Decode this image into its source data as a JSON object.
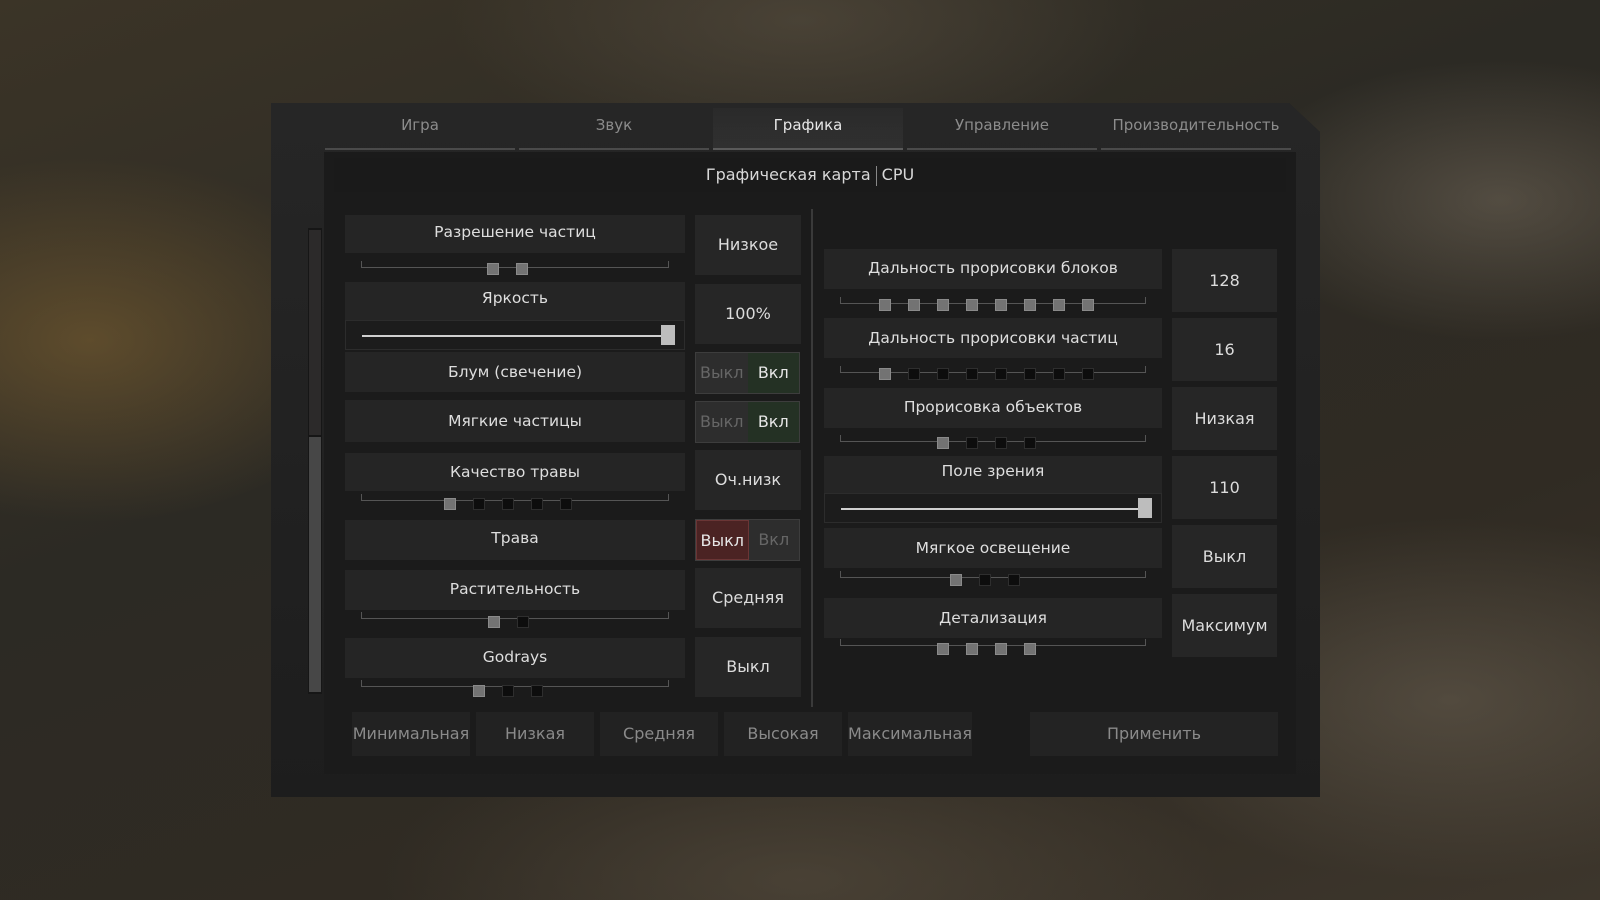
{
  "tabs": [
    "Игра",
    "Звук",
    "Графика",
    "Управление",
    "Производительность"
  ],
  "active_tab": "Графика",
  "subtabs": {
    "gpu": "Графическая карта",
    "cpu": "CPU"
  },
  "left": {
    "particle_res": {
      "label": "Разрешение частиц",
      "value": "Низкое",
      "levels": 2,
      "selected": 2
    },
    "brightness": {
      "label": "Яркость",
      "value": "100%",
      "level": 1.0
    },
    "bloom": {
      "label": "Блум (свечение)",
      "off": "Выкл",
      "on": "Вкл",
      "state": "on"
    },
    "soft_particles": {
      "label": "Мягкие частицы",
      "off": "Выкл",
      "on": "Вкл",
      "state": "on"
    },
    "grass_quality": {
      "label": "Качество травы",
      "value": "Оч.низк",
      "levels": 5,
      "selected": 1
    },
    "grass": {
      "label": "Трава",
      "off": "Выкл",
      "on": "Вкл",
      "state": "off"
    },
    "vegetation": {
      "label": "Растительность",
      "value": "Средняя",
      "levels": 2,
      "selected": 1
    },
    "godrays": {
      "label": "Godrays",
      "value": "Выкл",
      "levels": 3,
      "selected": 1
    }
  },
  "right": {
    "block_distance": {
      "label": "Дальность прорисовки блоков",
      "value": "128",
      "levels": 8,
      "selected": 8
    },
    "particle_distance": {
      "label": "Дальность прорисовки частиц",
      "value": "16",
      "levels": 8,
      "selected": 1
    },
    "object_draw": {
      "label": "Прорисовка объектов",
      "value": "Низкая",
      "levels": 4,
      "selected": 1
    },
    "fov": {
      "label": "Поле зрения",
      "value": "110",
      "level": 1.0
    },
    "soft_lighting": {
      "label": "Мягкое освещение",
      "value": "Выкл",
      "levels": 3,
      "selected": 1
    },
    "detail": {
      "label": "Детализация",
      "value": "Максимум",
      "levels": 4,
      "selected": 4
    }
  },
  "presets": [
    "Минимальная",
    "Низкая",
    "Средняя",
    "Высокая",
    "Максимальная"
  ],
  "apply_label": "Применить"
}
